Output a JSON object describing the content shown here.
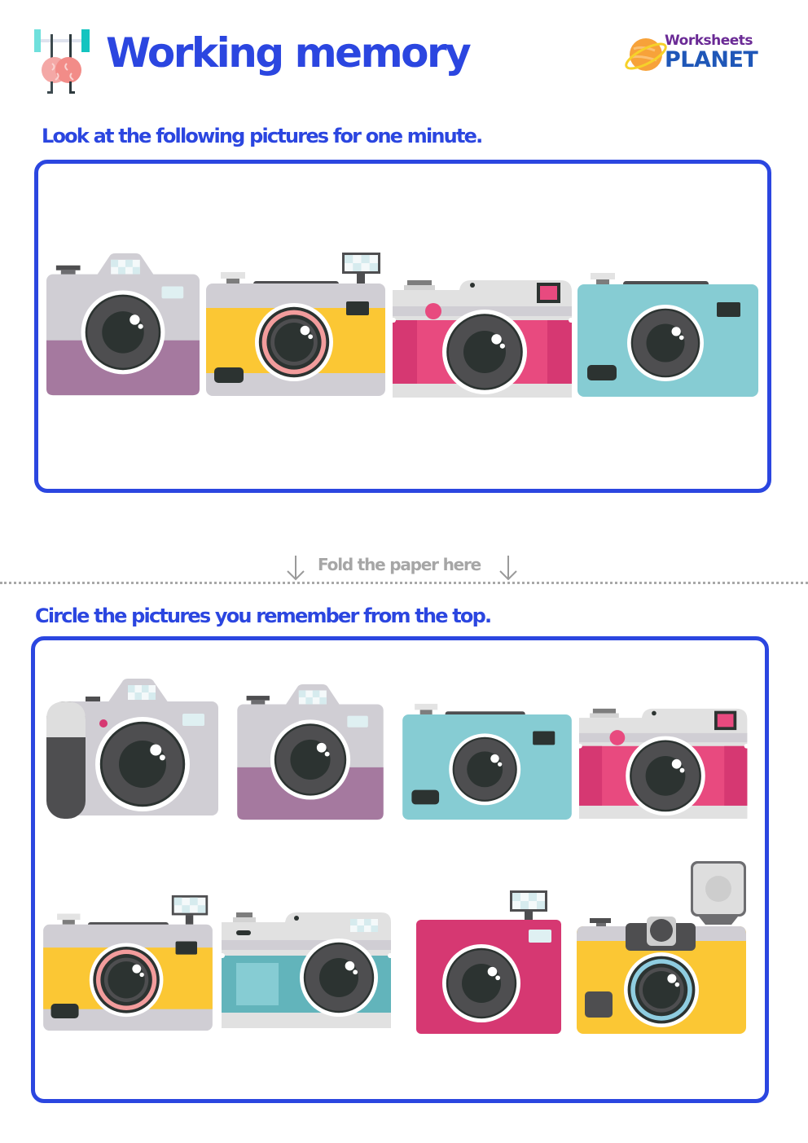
{
  "header": {
    "title": "Working memory",
    "icon": "brain-lifting-weights-icon",
    "logo": {
      "line1": "Worksheets",
      "line2": "PLANET",
      "icon": "planet-icon"
    }
  },
  "colors": {
    "accent": "#2b46e0",
    "fold_text": "#a6a6a6",
    "logo_purple": "#6a2a95",
    "logo_blue": "#1f57b8",
    "camera_grey": "#d0ced4",
    "camera_purple": "#a5799f",
    "camera_yellow": "#fbc734",
    "camera_pink": "#e84a7f",
    "camera_magenta": "#d63872",
    "camera_teal": "#86ccd3",
    "camera_dark_teal": "#62b4bb",
    "lens_dark": "#2c3331",
    "lens_mid": "#4e4e50"
  },
  "section_memorize": {
    "instruction": "Look at the following pictures for one minute.",
    "pictures": [
      {
        "type": "dslr-purple",
        "label": "Grey and purple DSLR camera"
      },
      {
        "type": "compact-yellow-flash",
        "label": "Yellow compact camera with flash"
      },
      {
        "type": "rangefinder-pink",
        "label": "Pink rangefinder camera"
      },
      {
        "type": "compact-teal",
        "label": "Teal compact camera"
      }
    ]
  },
  "fold": {
    "label": "Fold the paper here",
    "arrow_icon": "arrow-down-icon"
  },
  "section_recall": {
    "instruction": "Circle the pictures you remember from the top.",
    "pictures": [
      {
        "type": "dslr-grip",
        "label": "Grey DSLR camera with black grip"
      },
      {
        "type": "dslr-purple",
        "label": "Grey and purple DSLR camera"
      },
      {
        "type": "compact-teal",
        "label": "Teal compact camera"
      },
      {
        "type": "rangefinder-pink",
        "label": "Pink rangefinder camera"
      },
      {
        "type": "compact-yellow-flash",
        "label": "Yellow compact camera with flash"
      },
      {
        "type": "rangefinder-teal",
        "label": "Teal rangefinder camera"
      },
      {
        "type": "magenta-flash",
        "label": "Magenta camera with flash"
      },
      {
        "type": "yellow-big-flash",
        "label": "Yellow camera with big flash unit"
      }
    ]
  }
}
